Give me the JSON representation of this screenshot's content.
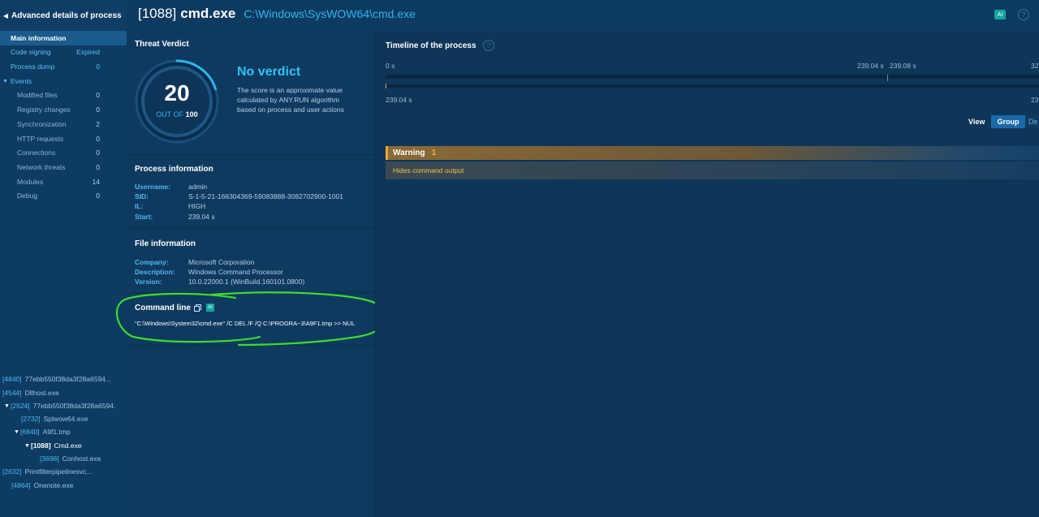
{
  "header": {
    "sidebar_title": "Advanced details of process",
    "pid": "[1088]",
    "process_name": "cmd.exe",
    "process_path": "C:\\Windows\\SysWOW64\\cmd.exe",
    "ai_badge": "AI",
    "help_glyph": "?"
  },
  "sidebar": {
    "main_information": "Main information",
    "code_signing": {
      "label": "Code signing",
      "value": "Expired"
    },
    "process_dump": {
      "label": "Process dump",
      "value": "0"
    },
    "events_label": "Events",
    "events": [
      {
        "label": "Modified files",
        "value": "0"
      },
      {
        "label": "Registry changes",
        "value": "0"
      },
      {
        "label": "Synchronization",
        "value": "2"
      },
      {
        "label": "HTTP requests",
        "value": "0"
      },
      {
        "label": "Connections",
        "value": "0"
      },
      {
        "label": "Network threats",
        "value": "0"
      },
      {
        "label": "Modules",
        "value": "14"
      },
      {
        "label": "Debug",
        "value": "0"
      }
    ]
  },
  "process_tree": [
    {
      "pid": "[4840]",
      "name": "77ebb550f38da3f28a6594..."
    },
    {
      "pid": "[4544]",
      "name": "Dllhost.exe"
    },
    {
      "pid": "[2524]",
      "name": "77ebb550f38da3f28a6594."
    },
    {
      "pid": "[2732]",
      "name": "Splwow64.exe"
    },
    {
      "pid": "[6840]",
      "name": "A9f1.tmp"
    },
    {
      "pid": "[1088]",
      "name": "Cmd.exe"
    },
    {
      "pid": "[3696]",
      "name": "Conhost.exe"
    },
    {
      "pid": "[2632]",
      "name": "Printfilterpipelinesvc..."
    },
    {
      "pid": "[4864]",
      "name": "Onenote.exe"
    }
  ],
  "verdict": {
    "section_title": "Threat Verdict",
    "score": "20",
    "out_of_prefix": "OUT OF",
    "out_of_value": "100",
    "score_fraction": 0.2,
    "title": "No verdict",
    "description": "The score is an approximate value calculated by ANY.RUN algorithm based on process and user actions"
  },
  "process_info": {
    "section_title": "Process information",
    "rows": [
      {
        "key": "Username:",
        "value": "admin"
      },
      {
        "key": "SID:",
        "value": "S-1-5-21-166304369-59083888-3082702900-1001"
      },
      {
        "key": "IL:",
        "value": "HIGH"
      },
      {
        "key": "Start:",
        "value": "239.04 s"
      }
    ]
  },
  "file_info": {
    "section_title": "File information",
    "rows": [
      {
        "key": "Company:",
        "value": "Microsoft Corporation"
      },
      {
        "key": "Description:",
        "value": "Windows Command Processor"
      },
      {
        "key": "Version:",
        "value": "10.0.22000.1 (WinBuild.160101.0800)"
      }
    ]
  },
  "command_line": {
    "section_title": "Command line",
    "ai_badge": "AI",
    "text": "\"C:\\Windows\\System32\\cmd.exe\" /C DEL /F /Q C:\\PROGRA~3\\A9F1.tmp >> NUL"
  },
  "timeline": {
    "title": "Timeline of the process",
    "start_label": "0 s",
    "mark_a": "239.04 s",
    "mark_b": "239.08 s",
    "end_label_top": "32",
    "lower_start": "239.04 s",
    "lower_end": "23",
    "view_label": "View",
    "view_group": "Group",
    "view_details": "De"
  },
  "warning": {
    "label": "Warning",
    "count": "1",
    "item": "Hides command output"
  },
  "colors": {
    "accent": "#2fb5ef",
    "warning": "#f0a630",
    "annotation": "#3ddc2b"
  }
}
